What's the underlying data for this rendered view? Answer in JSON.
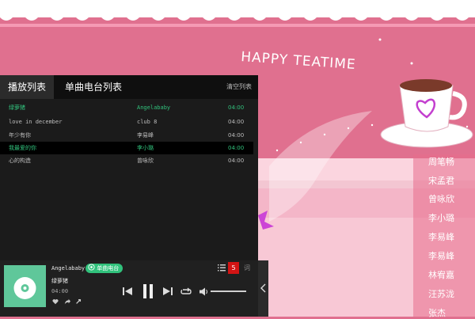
{
  "wallpaper": {
    "heading": "HAPPY TEATIME"
  },
  "playlist": {
    "tabs": [
      "播放列表",
      "单曲电台列表"
    ],
    "clear_label": "清空列表",
    "songs": [
      {
        "title": "绿萝猪",
        "artist": "Angelababy",
        "duration": "04:00",
        "playing": true
      },
      {
        "title": "love in december",
        "artist": "club 8",
        "duration": "04:00"
      },
      {
        "title": "年少有你",
        "artist": "李易峰",
        "duration": "04:00"
      },
      {
        "title": "我最爱的你",
        "artist": "李小璐",
        "duration": "04:00",
        "playing": true,
        "selected": true
      },
      {
        "title": "心的构造",
        "artist": "曾咏欣",
        "duration": "04:00"
      }
    ]
  },
  "player": {
    "artist": "Angelababy",
    "song": "绿萝猪",
    "time": "04:00",
    "radio_label": "单曲电台",
    "queue_count": "5",
    "lyrics_label": "词"
  },
  "singers": [
    "周笔畅",
    "宋孟君",
    "曾咏欣",
    "李小璐",
    "李易峰",
    "李易峰",
    "林宥嘉",
    "汪苏泷",
    "张杰"
  ],
  "colors": {
    "accent": "#31c27c",
    "badge": "#d21414",
    "bg_pink": "#e0708f"
  },
  "icons": [
    "list-icon",
    "prev-icon",
    "pause-icon",
    "next-icon",
    "loop-icon",
    "volume-icon",
    "heart-icon",
    "share-icon",
    "download-icon",
    "collapse-icon",
    "radio-icon"
  ]
}
